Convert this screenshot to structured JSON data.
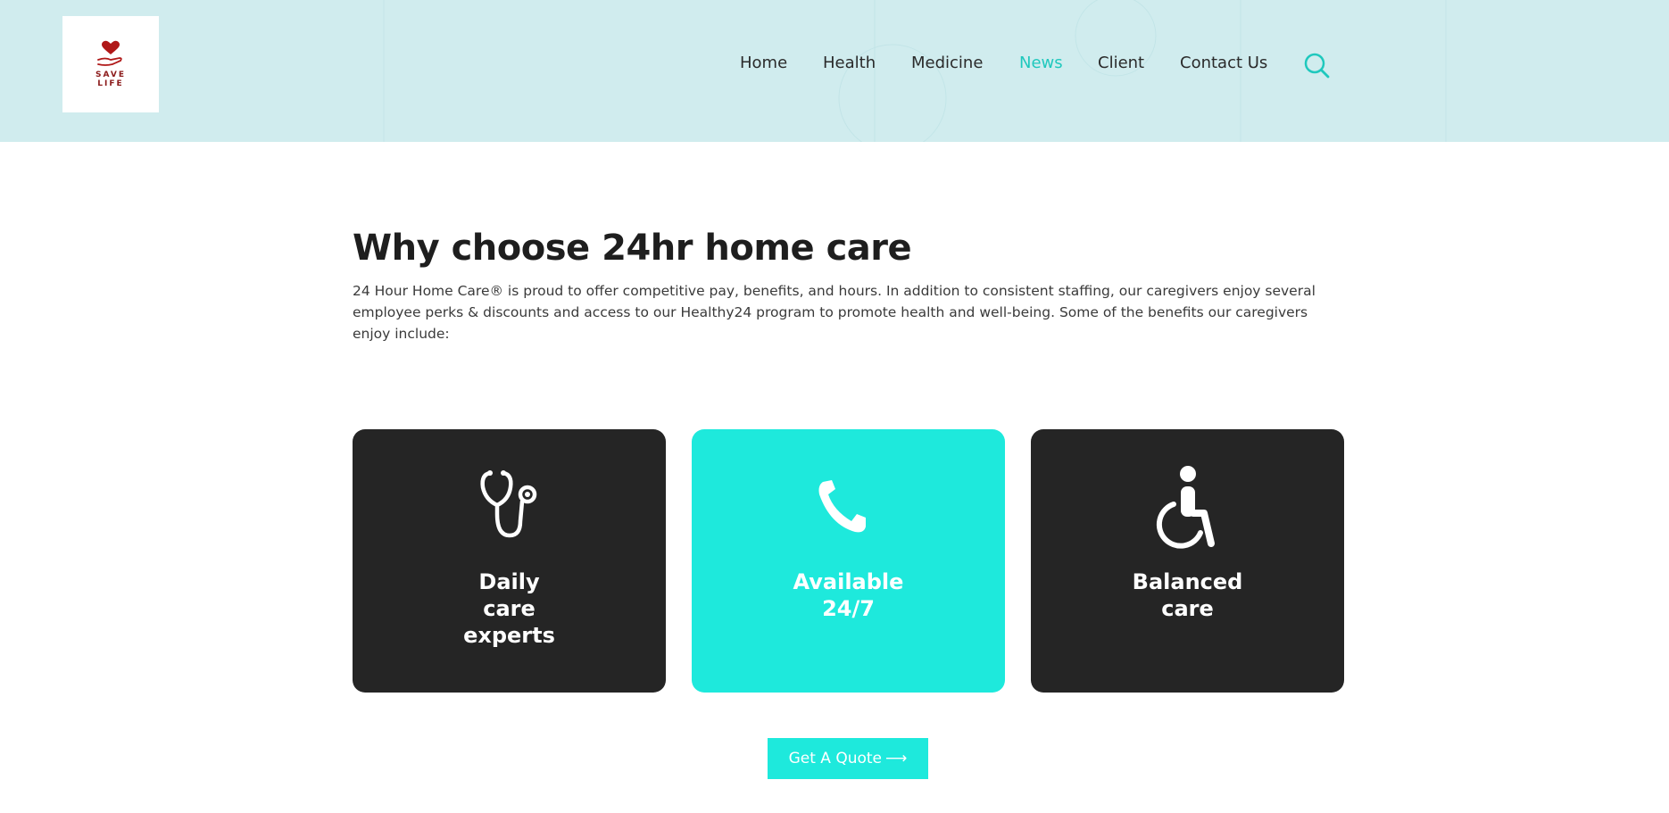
{
  "logo": {
    "text_line1": "SAVE",
    "text_line2": "LIFE"
  },
  "nav": {
    "items": [
      {
        "label": "Home"
      },
      {
        "label": "Health"
      },
      {
        "label": "Medicine"
      },
      {
        "label": "News",
        "active": true
      },
      {
        "label": "Client"
      },
      {
        "label": "Contact Us"
      }
    ],
    "search_icon": "search-icon"
  },
  "main": {
    "title": "Why choose 24hr home care",
    "intro": "24 Hour Home Care® is proud to offer competitive pay, benefits, and hours. In addition to consistent staffing, our caregivers enjoy several employee perks & discounts and access to our Healthy24 program to promote health and well-being. Some of the benefits our caregivers enjoy include:"
  },
  "cards": [
    {
      "icon": "stethoscope-icon",
      "lines": [
        "Daily",
        "care",
        "experts"
      ]
    },
    {
      "icon": "phone-icon",
      "lines": [
        "Available",
        "24/7"
      ]
    },
    {
      "icon": "wheelchair-icon",
      "lines": [
        "Balanced",
        "care"
      ]
    }
  ],
  "cta": {
    "label": "Get A Quote",
    "arrow": "⟶"
  },
  "colors": {
    "accent": "#1ee9dc",
    "nav_active": "#1fc8bd",
    "dark_card": "#252525",
    "header_bg": "#d0ecee",
    "logo_red": "#b01818"
  }
}
